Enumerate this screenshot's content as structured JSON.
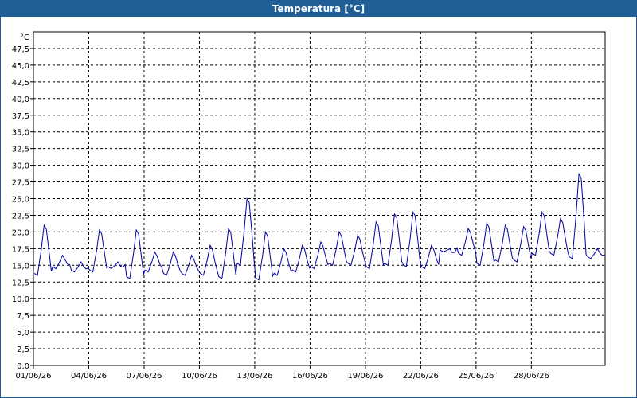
{
  "window": {
    "title": "Temperatura [°C]"
  },
  "colors": {
    "titlebar": "#1f5e96",
    "series": "#0000a0",
    "grid": "#000000",
    "background": "#ffffff"
  },
  "chart_data": {
    "type": "line",
    "title": "Temperatura [°C]",
    "ylabel": "°C",
    "xlabel": "",
    "ylim": [
      0,
      50
    ],
    "xlim": [
      "01/06/26",
      "02/07/26"
    ],
    "yticks": [
      "0,0",
      "2,5",
      "5,0",
      "7,5",
      "10,0",
      "12,5",
      "15,0",
      "17,5",
      "20,0",
      "22,5",
      "25,0",
      "27,5",
      "30,0",
      "32,5",
      "35,0",
      "37,5",
      "40,0",
      "42,5",
      "45,0",
      "47,5"
    ],
    "xticks": [
      "01/06/26",
      "04/06/26",
      "07/06/26",
      "10/06/26",
      "13/06/26",
      "16/06/26",
      "19/06/26",
      "22/06/26",
      "25/06/26",
      "28/06/26"
    ],
    "grid": true,
    "legend": "none",
    "series": [
      {
        "x": [
          "01/06/26",
          "02/06/26",
          "03/06/26",
          "04/06/26",
          "05/06/26",
          "06/06/26",
          "07/06/26",
          "08/06/26",
          "09/06/26",
          "10/06/26",
          "11/06/26",
          "12/06/26",
          "13/06/26",
          "14/06/26",
          "15/06/26",
          "16/06/26",
          "17/06/26",
          "18/06/26",
          "19/06/26",
          "20/06/26",
          "21/06/26",
          "22/06/26",
          "23/06/26",
          "24/06/26",
          "25/06/26",
          "26/06/26",
          "27/06/26",
          "28/06/26",
          "29/06/26",
          "30/06/26",
          "01/07/26"
        ],
        "min": [
          13.5,
          14.5,
          14.0,
          14.0,
          14.5,
          13.0,
          14.0,
          13.5,
          13.5,
          13.5,
          13.0,
          15.0,
          12.8,
          13.5,
          14.0,
          14.5,
          15.0,
          15.0,
          14.5,
          15.0,
          14.8,
          14.5,
          17.0,
          16.5,
          15.0,
          15.5,
          15.5,
          16.5,
          16.5,
          16.0,
          16.0
        ],
        "max": [
          21.0,
          16.5,
          15.5,
          20.3,
          15.5,
          20.3,
          17.0,
          17.0,
          16.5,
          18.0,
          20.5,
          25.0,
          20.0,
          17.5,
          18.0,
          18.5,
          20.0,
          19.5,
          21.5,
          22.7,
          23.0,
          18.0,
          17.5,
          20.5,
          21.3,
          21.0,
          20.8,
          23.0,
          22.0,
          28.7,
          17.5
        ]
      }
    ]
  }
}
